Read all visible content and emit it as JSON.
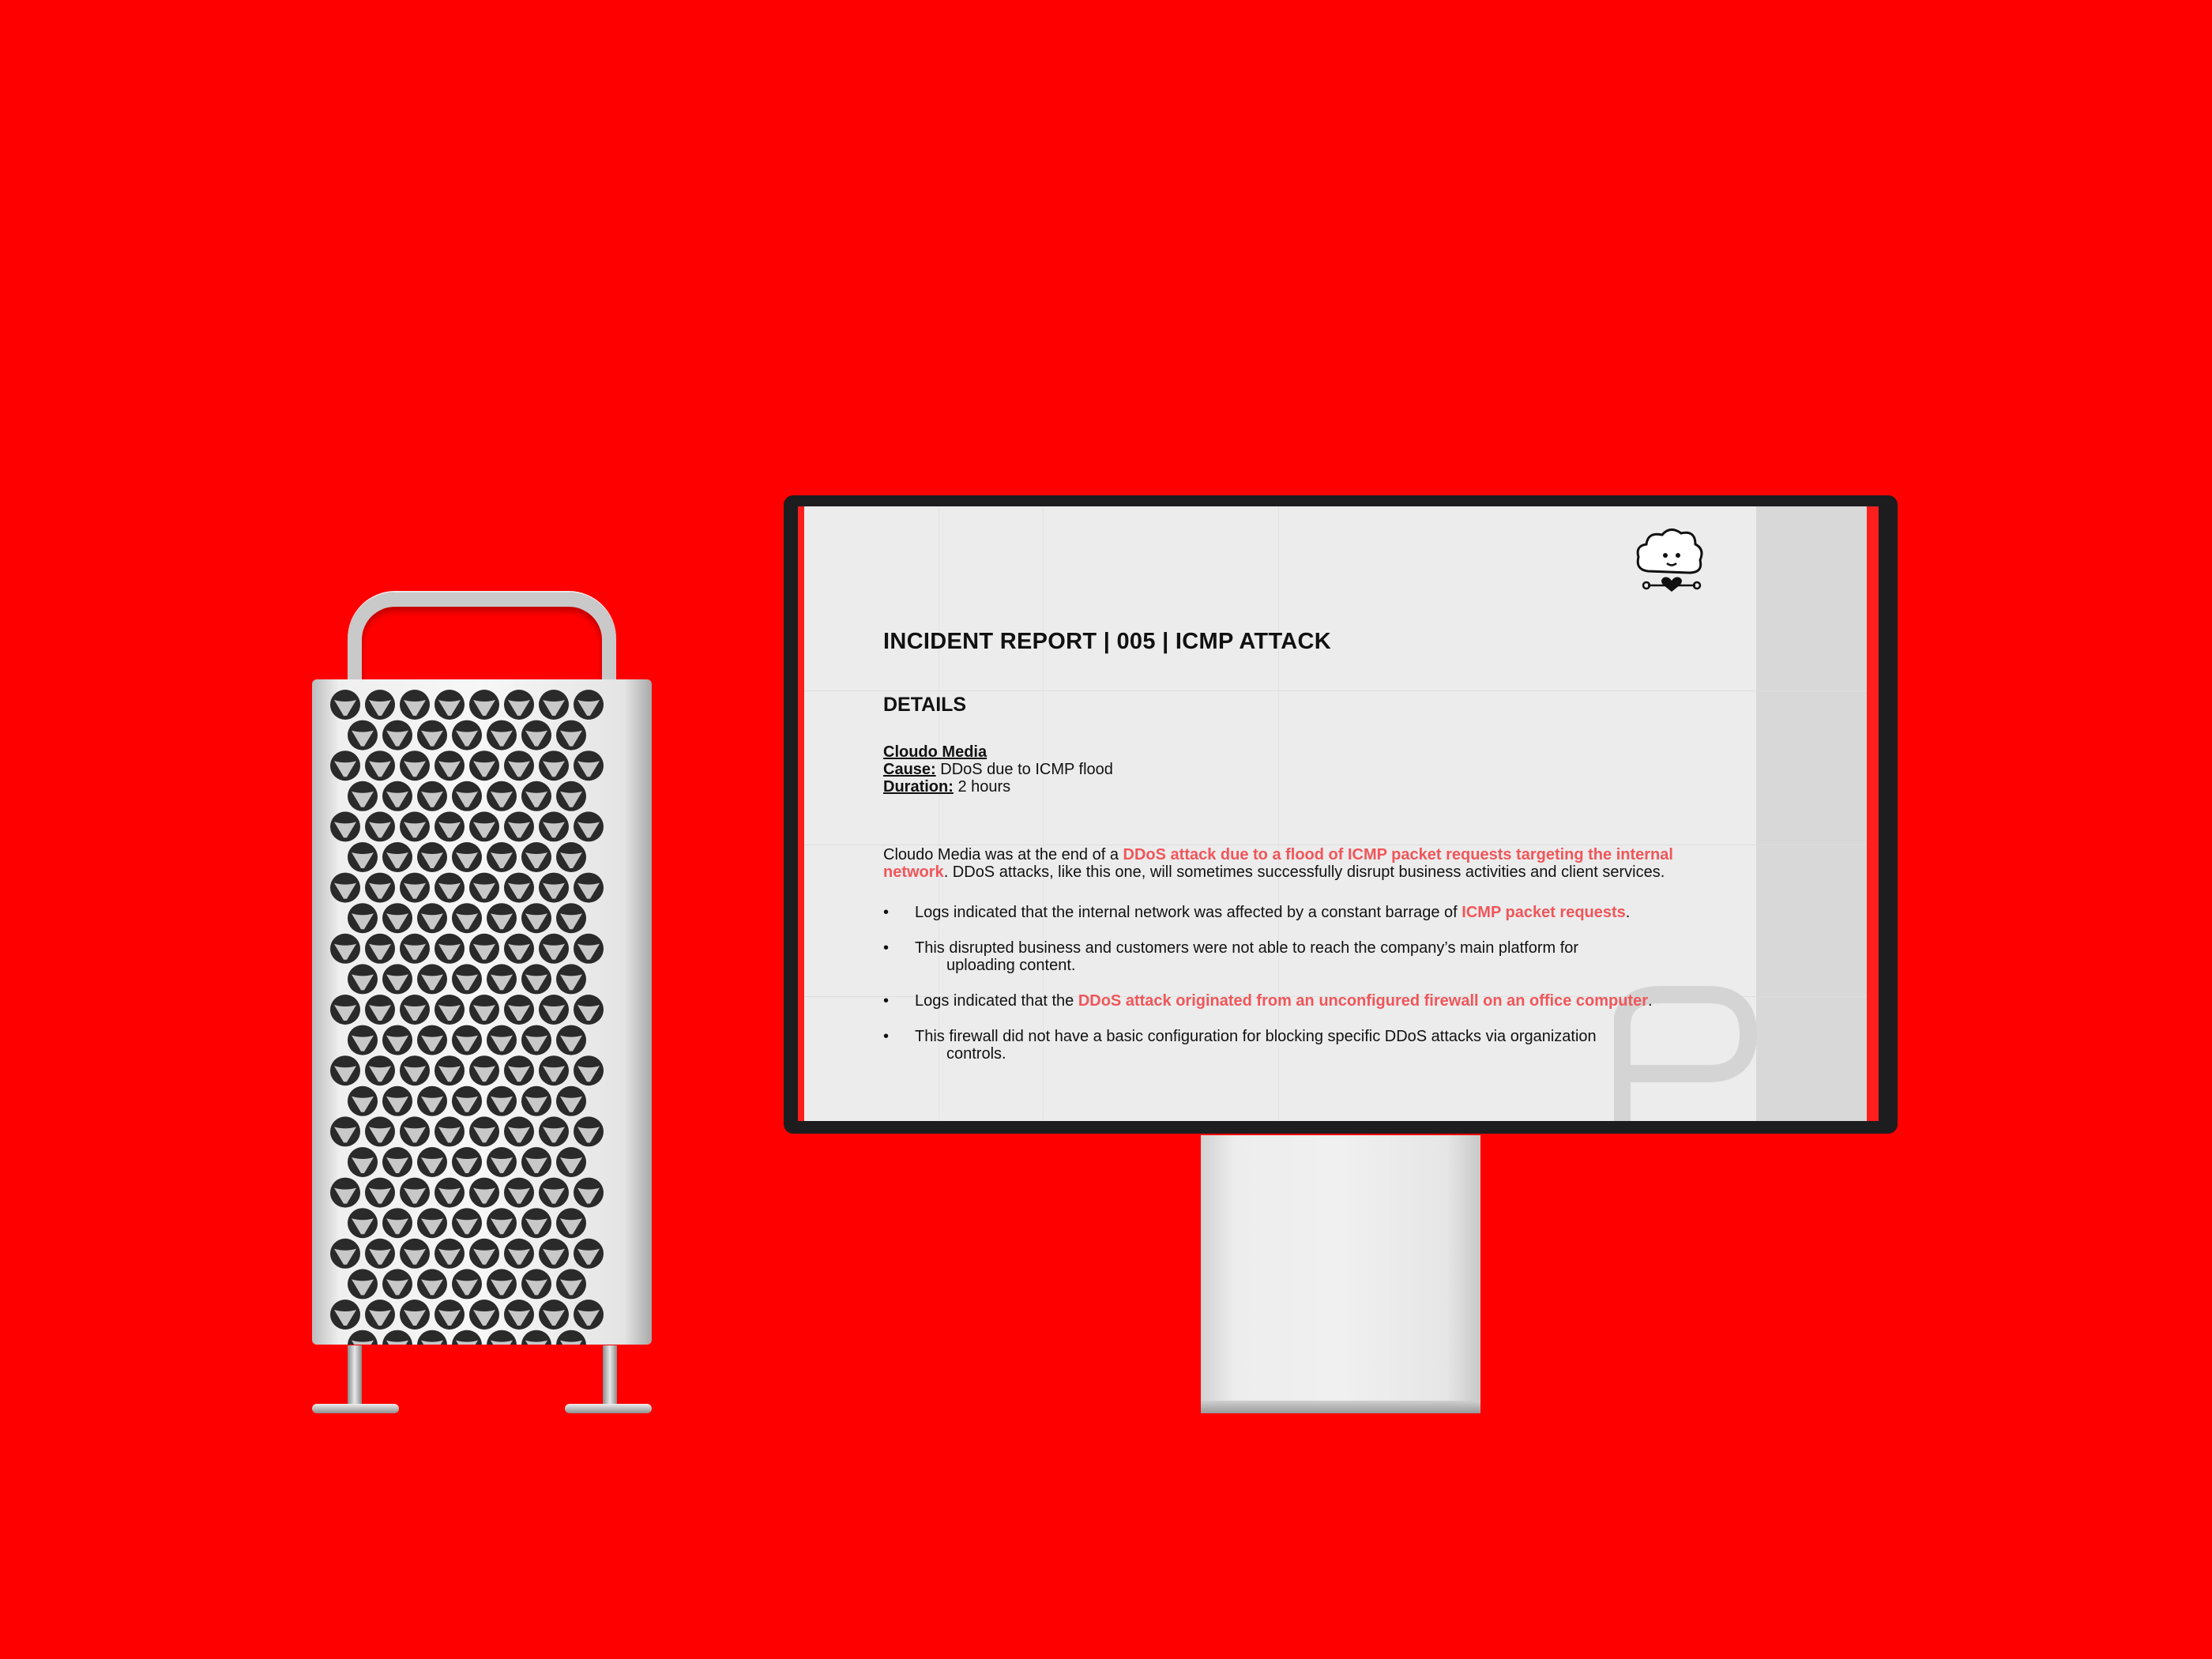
{
  "colors": {
    "background": "#ff0000",
    "highlight": "#f0565a",
    "bezel": "#1d1d1f"
  },
  "report": {
    "title": "INCIDENT REPORT | 005 | ICMP ATTACK",
    "section": "DETAILS",
    "company": "Cloudo Media",
    "cause_label": "Cause:",
    "cause_value": " DDoS due to ICMP flood",
    "duration_label": "Duration:",
    "duration_value": " 2 hours",
    "summary": {
      "p1": "Cloudo Media was at the end of a ",
      "h1": "DDoS attack due to a flood of ICMP packet requests targeting the internal network",
      "p2": ". DDoS attacks, like this one, will sometimes successfully disrupt business activities and client services."
    },
    "bullets": [
      {
        "text": "Logs indicated that the internal network was affected by a constant barrage of ",
        "highlight": "ICMP packet requests",
        "tail": ".",
        "cont": ""
      },
      {
        "text": "This disrupted business and customers were not able to reach the company’s main platform for",
        "highlight": "",
        "tail": "",
        "cont": "uploading content."
      },
      {
        "text": "Logs indicated that the ",
        "highlight": "DDoS attack originated from an unconfigured firewall on an office computer",
        "tail": ".",
        "cont": ""
      },
      {
        "text": "This firewall did not have a basic configuration for blocking specific DDoS attacks via organization",
        "highlight": "",
        "tail": "",
        "cont": "controls."
      }
    ],
    "bullet_symbol": "•"
  }
}
